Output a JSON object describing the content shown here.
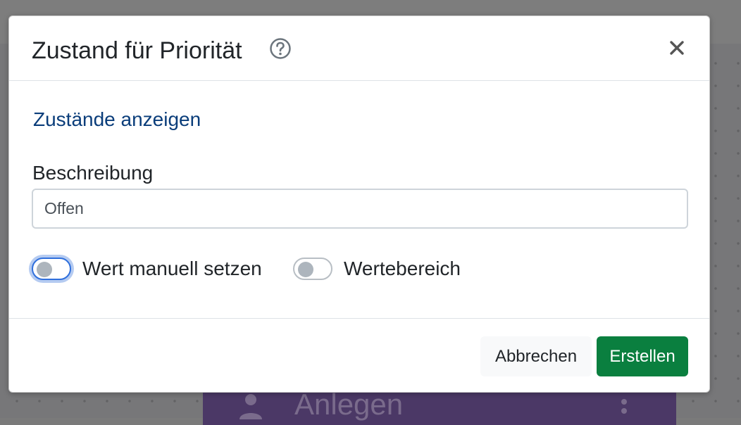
{
  "background": {
    "card_label": "Anlegen",
    "card_color": "#4b3866"
  },
  "modal": {
    "title": "Zustand für Priorität",
    "help_icon": "question-circle-icon",
    "close_icon": "close-icon",
    "show_states_link": "Zustände anzeigen",
    "description": {
      "label": "Beschreibung",
      "value": "Offen"
    },
    "toggles": {
      "manual": {
        "label": "Wert manuell setzen",
        "checked": false,
        "focused": true
      },
      "range": {
        "label": "Wertebereich",
        "checked": false
      }
    },
    "footer": {
      "cancel_label": "Abbrechen",
      "create_label": "Erstellen"
    }
  },
  "colors": {
    "link": "#0a3d7a",
    "primary_button": "#0a7f3f",
    "focus_ring": "#2f6fdc"
  }
}
